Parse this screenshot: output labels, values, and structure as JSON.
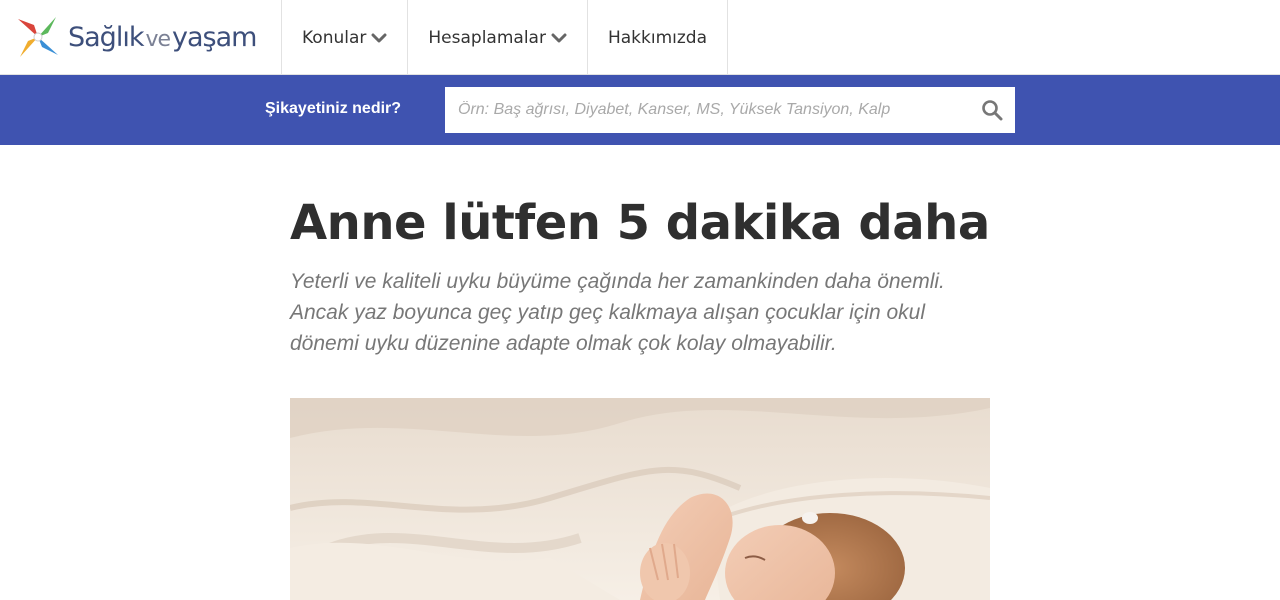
{
  "header": {
    "logo": {
      "word1": "Sağlık",
      "word2": "ve",
      "word3": "yaşam",
      "icon": "pinwheel-logo-icon"
    },
    "nav": [
      {
        "label": "Konular",
        "has_dropdown": true
      },
      {
        "label": "Hesaplamalar",
        "has_dropdown": true
      },
      {
        "label": "Hakkımızda",
        "has_dropdown": false
      }
    ]
  },
  "search": {
    "label": "Şikayetiniz nedir?",
    "placeholder": "Örn: Baş ağrısı, Diyabet, Kanser, MS, Yüksek Tansiyon, Kalp",
    "value": "",
    "icon": "search-icon"
  },
  "article": {
    "title": "Anne lütfen 5 dakika daha",
    "lead": "Yeterli ve kaliteli uyku büyüme çağında her zamankinden daha önemli. Ancak yaz boyunca geç yatıp geç kalkmaya alışan çocuklar için okul dönemi uyku düzenine adapte olmak çok kolay olmayabilir.",
    "image": "sleeping-child-in-bed-photo"
  },
  "colors": {
    "brand": "#3d4f7b",
    "band": "#3f53b0",
    "title": "#2f2f2f",
    "lead": "#777777"
  }
}
